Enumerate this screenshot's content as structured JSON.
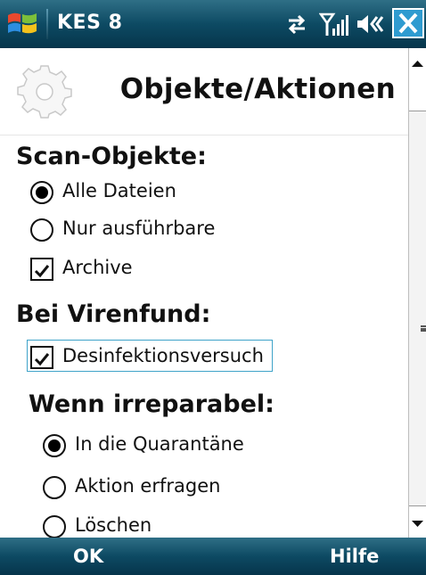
{
  "titlebar": {
    "app_title": "KES 8",
    "icons": [
      "windows-start-icon",
      "sync-icon",
      "signal-icon",
      "volume-icon",
      "close-icon"
    ]
  },
  "header": {
    "title": "Objekte/Aktionen",
    "icon": "gear-icon"
  },
  "scan_objects": {
    "heading": "Scan-Objekte:",
    "options": [
      {
        "label": "Alle Dateien",
        "type": "radio",
        "selected": true
      },
      {
        "label": "Nur ausführbare",
        "type": "radio",
        "selected": false
      },
      {
        "label": "Archive",
        "type": "checkbox",
        "checked": true
      }
    ]
  },
  "virus_found": {
    "heading": "Bei Virenfund:",
    "disinfect": {
      "label": "Desinfektionsversuch",
      "type": "checkbox",
      "checked": true,
      "focused": true
    }
  },
  "irreparable": {
    "heading": "Wenn irreparabel:",
    "options": [
      {
        "label": "In die Quarantäne",
        "type": "radio",
        "selected": true
      },
      {
        "label": "Aktion erfragen",
        "type": "radio",
        "selected": false
      },
      {
        "label": "Löschen",
        "type": "radio",
        "selected": false
      }
    ]
  },
  "softkeys": {
    "left": "OK",
    "right": "Hilfe"
  },
  "colors": {
    "titlebar": "#0d4a63",
    "focus_border": "#3fa3c9",
    "close_button": "#2f9bd0"
  }
}
